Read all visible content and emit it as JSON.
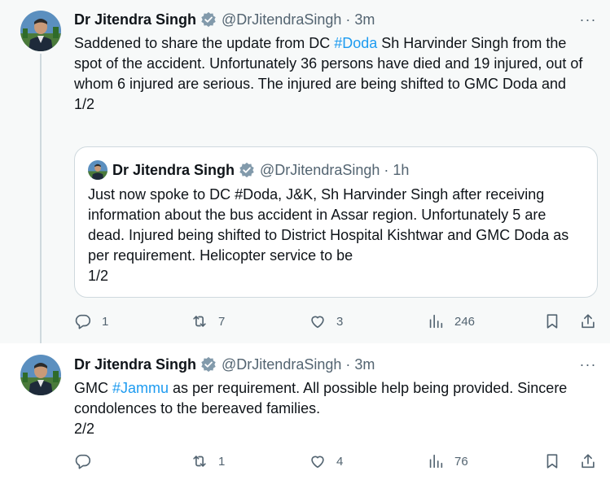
{
  "colors": {
    "accent": "#1d9bf0",
    "muted": "#536471",
    "text": "#0f1419",
    "border": "#cfd9de"
  },
  "tweets": [
    {
      "author": {
        "name": "Dr Jitendra Singh",
        "handle": "@DrJitendraSingh",
        "time": "3m"
      },
      "text": {
        "part1": "Saddened to share the update from DC ",
        "hashtag": "#Doda",
        "part2": " Sh Harvinder Singh from the spot of the accident. Unfortunately 36 persons have died and 19 injured, out of whom 6 injured are serious. The injured are being shifted to GMC Doda and",
        "part3": "1/2"
      },
      "quote": {
        "author": {
          "name": "Dr Jitendra Singh",
          "handle": "@DrJitendraSingh",
          "time": "1h"
        },
        "text": "Just now spoke to DC #Doda, J&K, Sh Harvinder Singh after receiving information about the bus accident in Assar region. Unfortunately 5 are dead. Injured being shifted to District Hospital Kishtwar and GMC Doda as per requirement. Helicopter service to be",
        "thread_marker": "1/2"
      },
      "actions": {
        "replies": "1",
        "retweets": "7",
        "likes": "3",
        "views": "246"
      }
    },
    {
      "author": {
        "name": "Dr Jitendra Singh",
        "handle": "@DrJitendraSingh",
        "time": "3m"
      },
      "text": {
        "part1": "GMC ",
        "hashtag": "#Jammu",
        "part2": " as per requirement. All possible help being provided. Sincere condolences to the bereaved families.",
        "part3": "2/2"
      },
      "actions": {
        "replies": "",
        "retweets": "1",
        "likes": "4",
        "views": "76"
      }
    }
  ],
  "icons": [
    "avatar-photo",
    "verified-badge-icon",
    "more-options-icon",
    "reply-icon",
    "retweet-icon",
    "like-icon",
    "views-icon",
    "bookmark-icon",
    "share-icon"
  ],
  "separator": "·",
  "more_glyph": "···"
}
